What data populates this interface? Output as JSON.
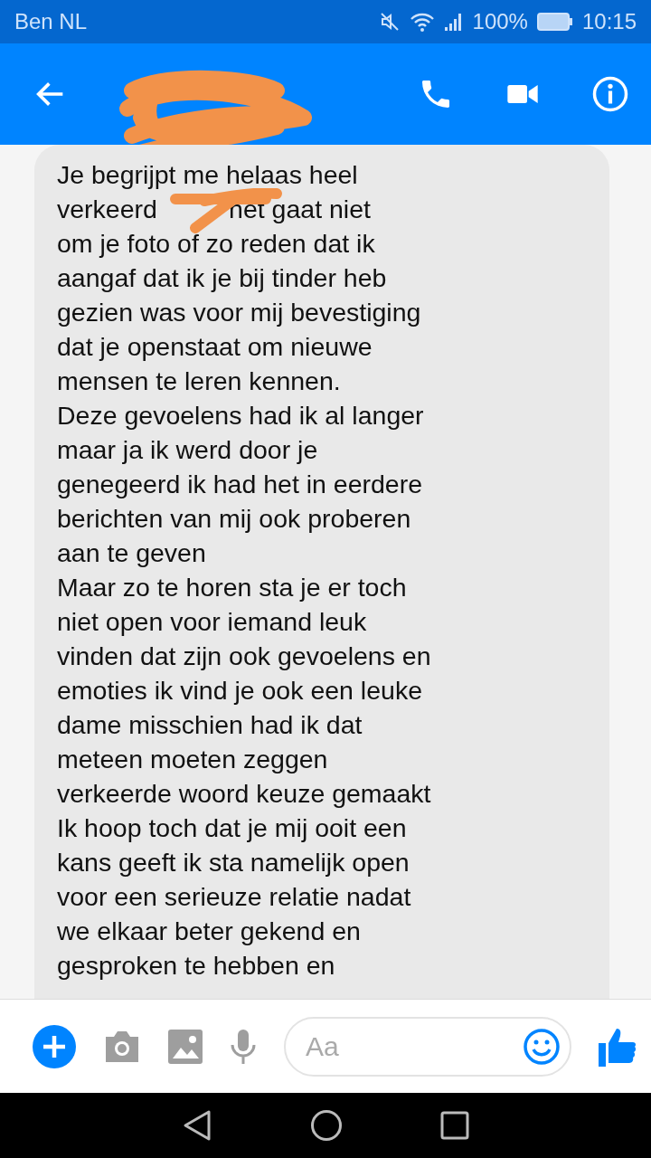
{
  "status_bar": {
    "carrier": "Ben NL",
    "battery": "100%",
    "time": "10:15"
  },
  "header": {
    "name_scribbled": true
  },
  "message": {
    "lines": [
      "Je begrijpt me helaas heel",
      "verkeerd          het gaat niet",
      "om je foto of zo reden dat ik",
      "aangaf dat ik je bij tinder heb",
      "gezien was voor mij bevestiging",
      "dat je openstaat om nieuwe",
      "mensen te leren kennen.",
      "Deze gevoelens had ik al langer",
      "maar ja ik werd door je",
      "genegeerd ik had het in eerdere",
      "berichten van mij ook proberen",
      "aan te geven",
      "Maar zo te horen sta je er toch",
      "niet open voor iemand leuk",
      "vinden dat zijn ook gevoelens en",
      "emoties ik vind je ook een leuke",
      "dame misschien had ik dat",
      "meteen moeten zeggen",
      "verkeerde woord keuze gemaakt",
      "Ik hoop toch dat je mij ooit een",
      "kans geeft ik sta namelijk open",
      "voor een serieuze relatie nadat",
      "we elkaar beter gekend en",
      "gesproken te hebben en"
    ],
    "scribbled": true
  },
  "composer": {
    "placeholder": "Aa"
  }
}
